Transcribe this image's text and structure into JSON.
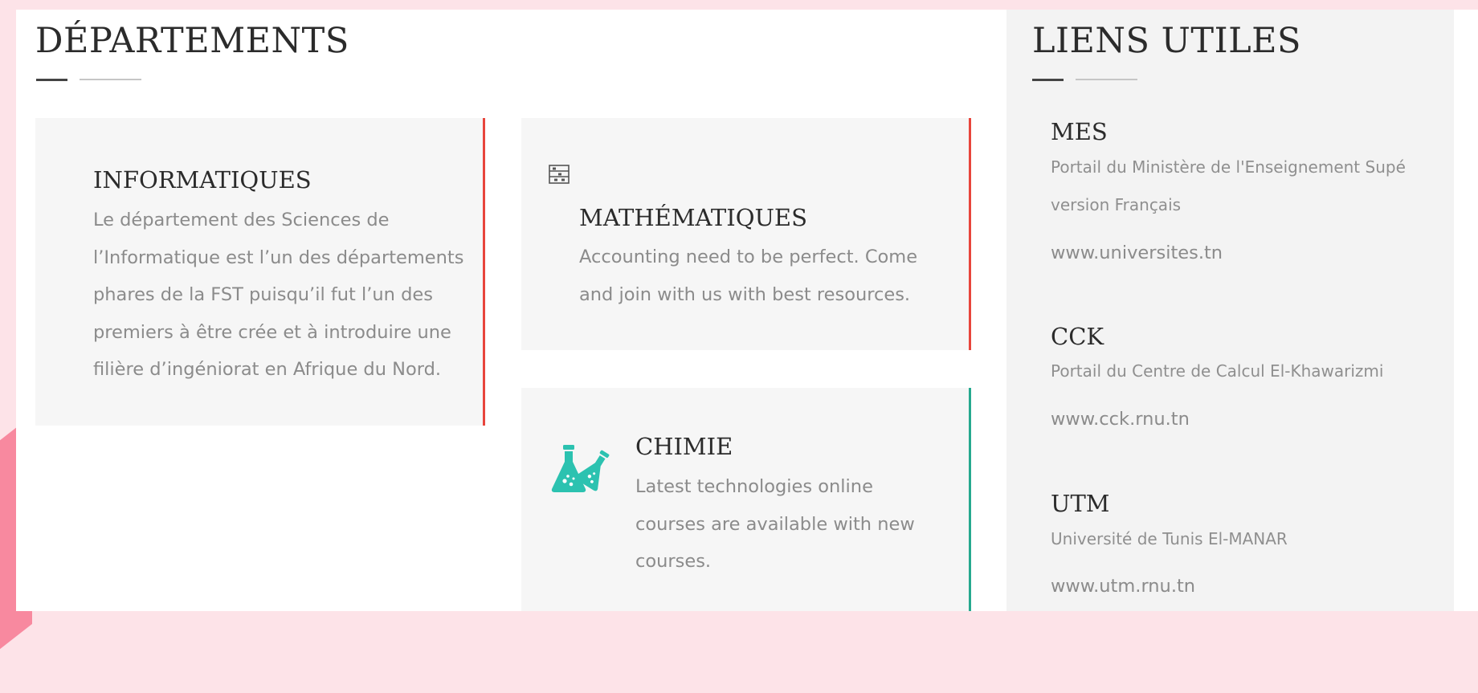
{
  "departments": {
    "title": "DÉPARTEMENTS",
    "cards": [
      {
        "title": "INFORMATIQUES",
        "text_lines": [
          "Le département des Sciences de",
          "l’Informatique est l’un des départements",
          "phares de la FST puisqu’il fut l’un des",
          "premiers à être crée et à introduire une",
          "filière d’ingéniorat en Afrique du Nord."
        ],
        "accent": "#e8453c"
      },
      {
        "icon": "abacus-icon",
        "title": "MATHÉMATIQUES",
        "text_lines": [
          "Accounting need to be perfect. Come",
          "and join with us with best resources."
        ],
        "accent": "#e8453c"
      },
      {
        "icon": "lab-flasks-icon",
        "title": "CHIMIE",
        "text_lines": [
          "Latest technologies online",
          "courses are available with new",
          "courses."
        ],
        "accent": "#26a98f",
        "icon_color": "#2cc2b0"
      }
    ]
  },
  "useful_links": {
    "title": "LIENS UTILES",
    "items": [
      {
        "title": "MES",
        "desc_lines": [
          "Portail du Ministère de l'Enseignement Supé",
          "version Français"
        ],
        "url": "www.universites.tn"
      },
      {
        "title": "CCK",
        "desc_lines": [
          "Portail du Centre de Calcul El-Khawarizmi"
        ],
        "url": "www.cck.rnu.tn"
      },
      {
        "title": "UTM",
        "desc_lines": [
          "Université de Tunis El-MANAR"
        ],
        "url": "www.utm.rnu.tn"
      }
    ]
  }
}
